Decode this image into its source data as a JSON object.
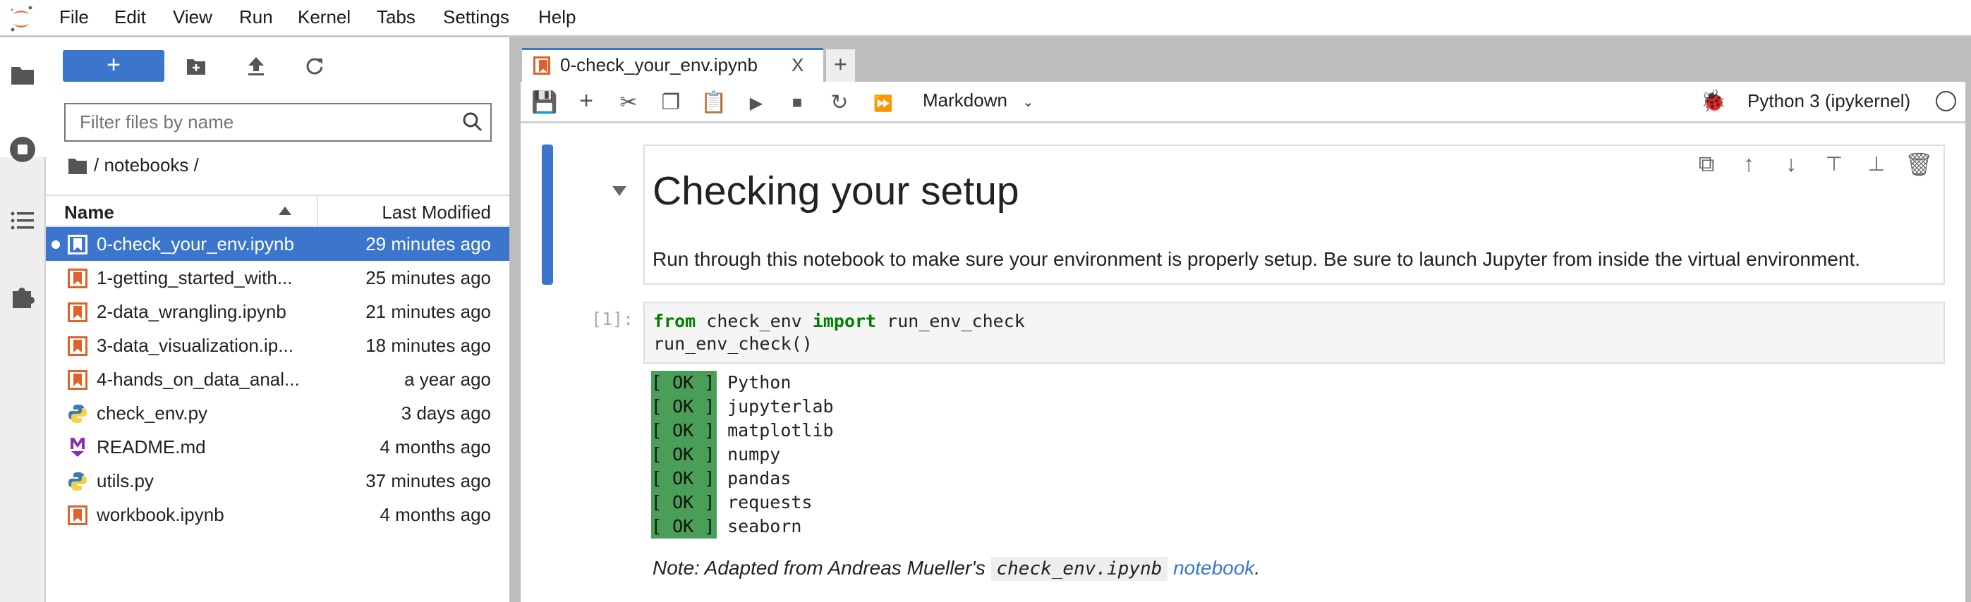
{
  "menu": [
    "File",
    "Edit",
    "View",
    "Run",
    "Kernel",
    "Tabs",
    "Settings",
    "Help"
  ],
  "filebrowser": {
    "new_label": "+",
    "filter_placeholder": "Filter files by name",
    "breadcrumb": "/ notebooks /",
    "columns": {
      "name": "Name",
      "modified": "Last Modified"
    },
    "files": [
      {
        "name": "0-check_your_env.ipynb",
        "modified": "29 minutes ago",
        "type": "notebook",
        "selected": true,
        "running": true
      },
      {
        "name": "1-getting_started_with...",
        "modified": "25 minutes ago",
        "type": "notebook"
      },
      {
        "name": "2-data_wrangling.ipynb",
        "modified": "21 minutes ago",
        "type": "notebook"
      },
      {
        "name": "3-data_visualization.ip...",
        "modified": "18 minutes ago",
        "type": "notebook"
      },
      {
        "name": "4-hands_on_data_anal...",
        "modified": "a year ago",
        "type": "notebook"
      },
      {
        "name": "check_env.py",
        "modified": "3 days ago",
        "type": "python"
      },
      {
        "name": "README.md",
        "modified": "4 months ago",
        "type": "markdown"
      },
      {
        "name": "utils.py",
        "modified": "37 minutes ago",
        "type": "python"
      },
      {
        "name": "workbook.ipynb",
        "modified": "4 months ago",
        "type": "notebook"
      }
    ]
  },
  "tab": {
    "title": "0-check_your_env.ipynb",
    "close": "X",
    "add": "+"
  },
  "toolbar": {
    "cell_type": "Markdown",
    "kernel": "Python 3 (ipykernel)"
  },
  "notebook": {
    "heading": "Checking your setup",
    "paragraph": "Run through this notebook to make sure your environment is properly setup. Be sure to launch Jupyter from inside the virtual environment.",
    "prompt": "[1]:",
    "code": {
      "kw1": "from",
      "mod": " check_env ",
      "kw2": "import",
      "fn": " run_env_check",
      "line2": "run_env_check()"
    },
    "ok_label": "[ OK ]",
    "outputs": [
      "Python",
      "jupyterlab",
      "matplotlib",
      "numpy",
      "pandas",
      "requests",
      "seaborn"
    ],
    "note": {
      "prefix": "Note: Adapted from Andreas Mueller's ",
      "code": "check_env.ipynb",
      "link": "notebook",
      "suffix": "."
    }
  },
  "colors": {
    "accent": "#3b76cc",
    "ok": "#4a9e58",
    "notebook_icon": "#e0622a",
    "keyword": "#008000"
  }
}
